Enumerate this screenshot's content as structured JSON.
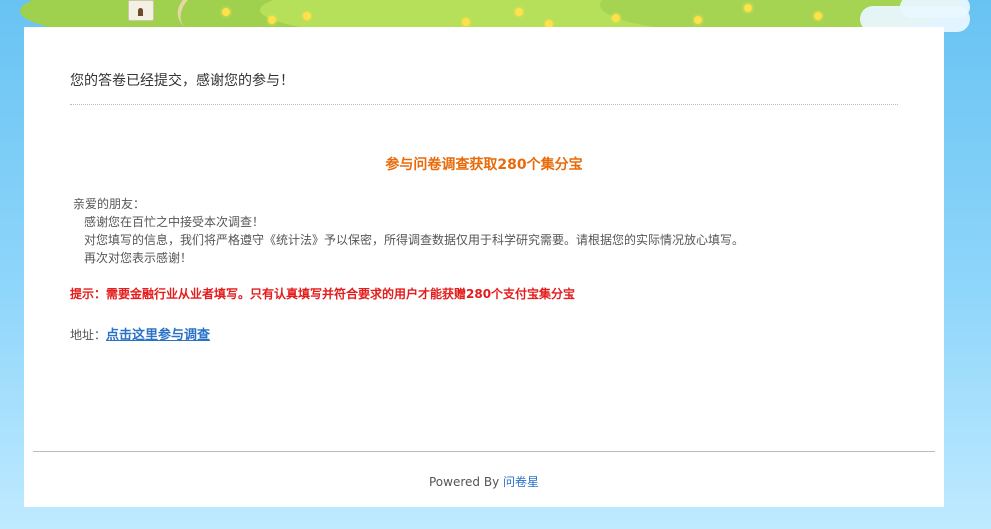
{
  "header": {
    "decorations": [
      "windmill-icon",
      "flower-icon",
      "cloud-icon",
      "grass-hill"
    ]
  },
  "main": {
    "submitted_message": "您的答卷已经提交，感谢您的参与！",
    "promo_title": "参与问卷调查获取280个集分宝",
    "greeting": "亲爱的朋友：",
    "paragraphs": [
      "感谢您在百忙之中接受本次调查！",
      "对您填写的信息，我们将严格遵守《统计法》予以保密，所得调查数据仅用于科学研究需要。请根据您的实际情况放心填写。",
      "再次对您表示感谢！"
    ],
    "tip": "提示：需要金融行业从业者填写。只有认真填写并符合要求的用户才能获赠280个支付宝集分宝",
    "address_label": "地址：",
    "address_link": "点击这里参与调查"
  },
  "footer": {
    "powered_by": "Powered By ",
    "brand": "问卷星"
  },
  "colors": {
    "background_sky": "#68c3f2",
    "panel": "#ffffff",
    "promo_title": "#e86a0a",
    "tip": "#e41c1c",
    "link": "#2a72c6"
  }
}
